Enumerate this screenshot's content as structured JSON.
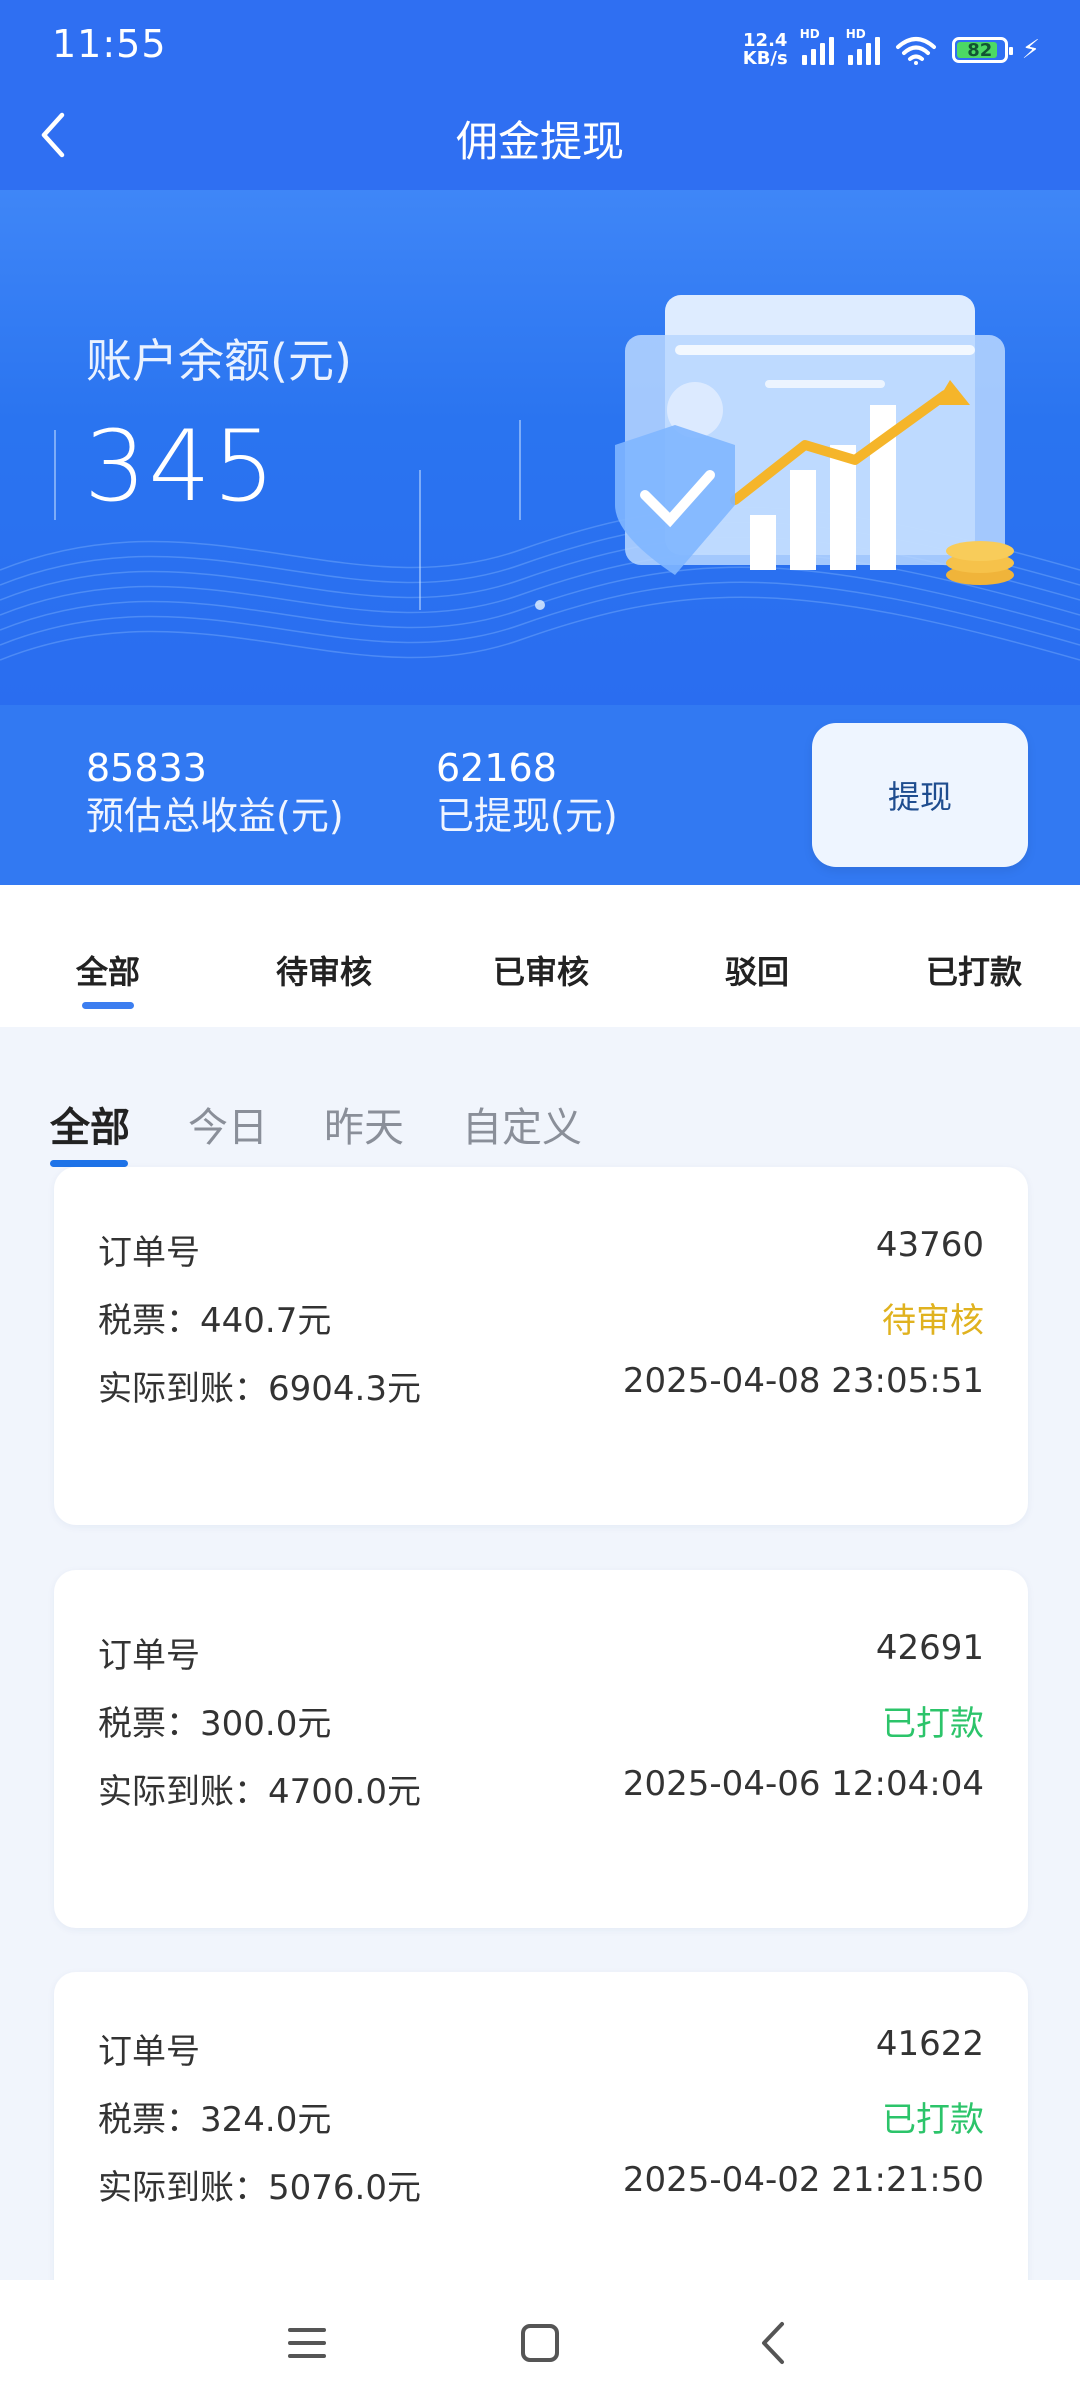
{
  "status_bar": {
    "time": "11:55",
    "net_speed_top": "12.4",
    "net_speed_bottom": "KB/s",
    "hd1": "HD",
    "hd2": "HD",
    "battery": "82"
  },
  "header": {
    "title": "佣金提现"
  },
  "balance": {
    "label": "账户余额(元)",
    "value": "345"
  },
  "summary": {
    "estimated_total": "85833",
    "estimated_total_label": "预估总收益(元)",
    "withdrawn": "62168",
    "withdrawn_label": "已提现(元)",
    "withdraw_button": "提现"
  },
  "status_tabs": [
    "全部",
    "待审核",
    "已审核",
    "驳回",
    "已打款"
  ],
  "date_tabs": [
    "全部",
    "今日",
    "昨天",
    "自定义"
  ],
  "records": [
    {
      "order_label": "订单号",
      "order_no": "43760",
      "tax_label": "税票：440.7元",
      "status": "待审核",
      "actual_label": "实际到账：6904.3元",
      "time": "2025-04-08 23:05:51"
    },
    {
      "order_label": "订单号",
      "order_no": "42691",
      "tax_label": "税票：300.0元",
      "status": "已打款",
      "actual_label": "实际到账：4700.0元",
      "time": "2025-04-06 12:04:04"
    },
    {
      "order_label": "订单号",
      "order_no": "41622",
      "tax_label": "税票：324.0元",
      "status": "已打款",
      "actual_label": "实际到账：5076.0元",
      "time": "2025-04-02 21:21:50"
    }
  ],
  "colors": {
    "primary": "#2f6ff2",
    "pending": "#e0b21f",
    "paid": "#2cc46a"
  },
  "icons": [
    "back-icon",
    "signal-icon",
    "wifi-icon",
    "battery-icon",
    "charging-icon",
    "menu-icon",
    "home-icon",
    "back-nav-icon"
  ]
}
